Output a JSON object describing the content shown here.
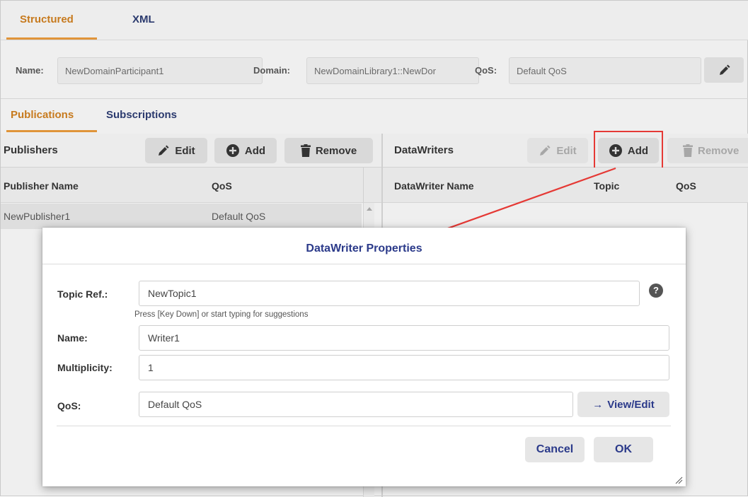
{
  "top_tabs": {
    "structured": "Structured",
    "xml": "XML"
  },
  "participant": {
    "name_label": "Name:",
    "name_value": "NewDomainParticipant1",
    "domain_label": "Domain:",
    "domain_value": "NewDomainLibrary1::NewDor",
    "qos_label": "QoS:",
    "qos_value": "Default QoS",
    "edit_icon": "pencil-icon"
  },
  "sub_tabs": {
    "publications": "Publications",
    "subscriptions": "Subscriptions"
  },
  "publishers": {
    "title": "Publishers",
    "edit_label": "Edit",
    "add_label": "Add",
    "remove_label": "Remove",
    "columns": [
      "Publisher Name",
      "QoS"
    ],
    "rows": [
      {
        "name": "NewPublisher1",
        "qos": "Default QoS"
      }
    ]
  },
  "datawriters": {
    "title": "DataWriters",
    "edit_label": "Edit",
    "add_label": "Add",
    "remove_label": "Remove",
    "columns": [
      "DataWriter Name",
      "Topic",
      "QoS"
    ]
  },
  "dialog": {
    "title": "DataWriter Properties",
    "topic_ref_label": "Topic Ref.:",
    "topic_ref_value": "NewTopic1",
    "topic_hint": "Press [Key Down] or start typing for suggestions",
    "help_glyph": "?",
    "name_label": "Name:",
    "name_value": "Writer1",
    "multiplicity_label": "Multiplicity:",
    "multiplicity_value": "1",
    "qos_label": "QoS:",
    "qos_value": "Default QoS",
    "view_edit_label": "View/Edit",
    "view_edit_arrow": "→",
    "cancel_label": "Cancel",
    "ok_label": "OK"
  },
  "colors": {
    "active_tab": "#c77a1e",
    "tab_underline": "#e0943a",
    "link_blue": "#2b3a8a",
    "highlight_red": "#e53935"
  }
}
